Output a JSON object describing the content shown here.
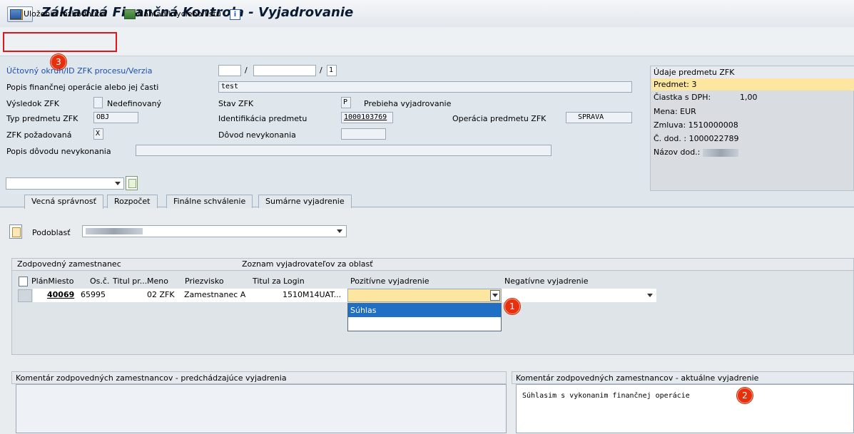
{
  "window": {
    "title": "Základná Finančná Kontrola - Vyjadrovanie"
  },
  "toolbar": {
    "save_label": "Uloženie rozhodnutia",
    "preview_label": "Náhľad krycieho listu"
  },
  "badges": {
    "b1": "1",
    "b2": "2",
    "b3": "3"
  },
  "header": {
    "ucet_label": "Účtovný okruh/ID ZFK procesu/Verzia",
    "ucet_sep": "/",
    "verzia_value": "1",
    "popis_label": "Popis finančnej operácie alebo jej časti",
    "popis_value": "test",
    "vysledok_label": "Výsledok ZFK",
    "vysledok_text": "Nedefinovaný",
    "stav_label": "Stav ZFK",
    "stav_code": "P",
    "stav_text": "Prebieha vyjadrovanie",
    "typ_label": "Typ predmetu ZFK",
    "typ_value": "OBJ",
    "ident_label": "Identifikácia predmetu",
    "ident_value": "1000103769",
    "oper_label": "Operácia predmetu ZFK",
    "oper_value": "SPRAVA",
    "pozadovana_label": "ZFK požadovaná",
    "pozadovana_value": "X",
    "dovod_label": "Dôvod nevykonania",
    "popis_dovodu_label": "Popis dôvodu nevykonania"
  },
  "subject_panel": {
    "title": "Údaje predmetu ZFK",
    "predmet": "Predmet: 3",
    "ciastka_label": "Čiastka s DPH:",
    "ciastka_value": "1,00",
    "mena": "Mena: EUR",
    "zmluva": "Zmluva: 1510000008",
    "dod": "Č. dod. : 1000022789",
    "nazov": "Názov dod.:"
  },
  "tabs": [
    "Vecná správnosť",
    "Rozpočet",
    "Finálne schválenie",
    "Sumárne vyjadrenie"
  ],
  "podoblast": {
    "label": "Podoblasť"
  },
  "grid": {
    "title_left": "Zodpovedný zamestnanec",
    "title_right": "Zoznam vyjadrovateľov za oblasť",
    "columns": [
      "PlánMiesto",
      "Os.č.",
      "Titul pr...",
      "Meno",
      "Priezvisko",
      "Titul za",
      "Login",
      "Pozitívne vyjadrenie",
      "Negatívne vyjadrenie"
    ],
    "row": {
      "planmiesto": "40069",
      "osc": "65995",
      "meno": "02 ZFK",
      "priezvisko": "Zamestnanec A",
      "login": "1510M14UAT..."
    },
    "dropdown_options": [
      "Súhlas",
      ""
    ]
  },
  "comments": {
    "prev_title": "Komentár zodpovedných zamestnancov - predchádzajúce vyjadrenia",
    "curr_title": "Komentár zodpovedných zamestnancov - aktuálne vyjadrenie",
    "curr_text": "Súhlasim s vykonanim finančnej operácie"
  }
}
